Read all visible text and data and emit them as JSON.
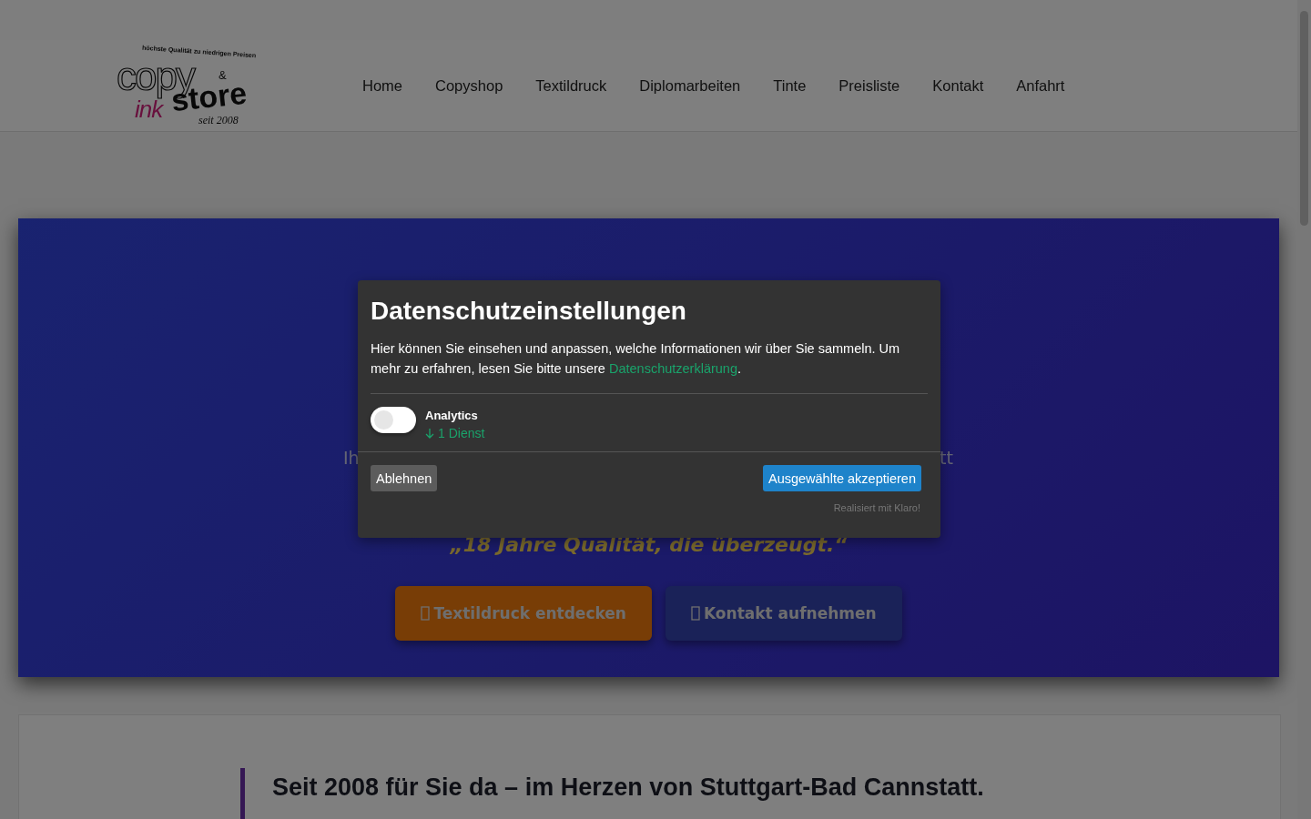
{
  "logo": {
    "tagline": "höchste Qualität zu niedrigen Preisen",
    "word_1": "copy",
    "ampersand": "&",
    "word_2": "ink",
    "word_3": "store",
    "since": "seit 2008"
  },
  "nav": [
    {
      "label": "Home"
    },
    {
      "label": "Copyshop"
    },
    {
      "label": "Textildruck"
    },
    {
      "label": "Diplomarbeiten"
    },
    {
      "label": "Tinte"
    },
    {
      "label": "Preisliste"
    },
    {
      "label": "Kontakt"
    },
    {
      "label": "Anfahrt"
    }
  ],
  "hero": {
    "subtitle_left": "Ih",
    "subtitle_right": "tt",
    "quote": "„18 Jahre Qualität, die überzeugt.“",
    "buttons": [
      {
        "label": "Textildruck entdecken",
        "kind": "primary"
      },
      {
        "label": "Kontakt aufnehmen",
        "kind": "secondary"
      }
    ]
  },
  "section": {
    "heading": "Seit 2008 für Sie da – im Herzen von Stuttgart-Bad Cannstatt."
  },
  "consent": {
    "title": "Datenschutzeinstellungen",
    "text_before": "Hier können Sie einsehen und anpassen, welche Informationen wir über Sie sammeln. Um mehr zu erfahren, lesen Sie bitte unsere",
    "link": "Datenschutzerklärung",
    "text_after": ".",
    "services": [
      {
        "name": "Analytics",
        "on": false,
        "count": "1 Dienst"
      }
    ],
    "decline": "Ablehnen",
    "accept": "Ausgewählte akzeptieren",
    "credit": "Realisiert mit Klaro!"
  }
}
